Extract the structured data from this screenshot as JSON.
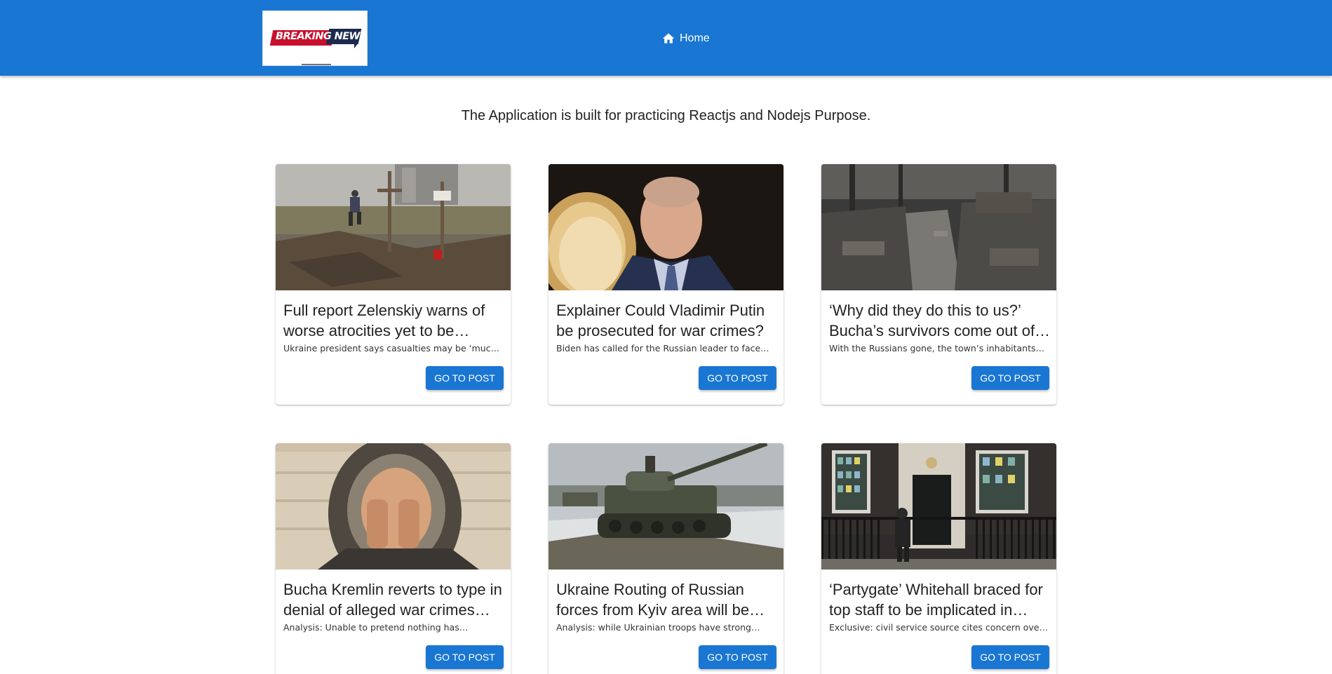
{
  "header": {
    "logo_text": "BREAKING NEWS",
    "nav_home_label": "Home",
    "home_icon": "home-icon"
  },
  "main": {
    "tagline": "The Application is built for practicing Reactjs and Nodejs Purpose."
  },
  "posts": [
    {
      "title": "Full report Zelenskiy warns of worse atrocities yet to be…",
      "description": "Ukraine president says casualties may be ‘much…",
      "button_label": "GO TO POST"
    },
    {
      "title": "Explainer Could Vladimir Putin be prosecuted for war crimes?",
      "description": "Biden has called for the Russian leader to face…",
      "button_label": "GO TO POST"
    },
    {
      "title": "‘Why did they do this to us?’ Bucha’s survivors come out of…",
      "description": "With the Russians gone, the town’s inhabitants…",
      "button_label": "GO TO POST"
    },
    {
      "title": "Bucha Kremlin reverts to type in denial of alleged war crimes in…",
      "description": "Analysis: Unable to pretend nothing has…",
      "button_label": "GO TO POST"
    },
    {
      "title": "Ukraine Routing of Russian forces from Kyiv area will be…",
      "description": "Analysis: while Ukrainian troops have strong…",
      "button_label": "GO TO POST"
    },
    {
      "title": "‘Partygate’ Whitehall braced for top staff to be implicated in Su…",
      "description": "Exclusive: civil service source cites concern over…",
      "button_label": "GO TO POST"
    }
  ],
  "colors": {
    "appbar": "#1976d2",
    "button": "#1976d2",
    "logo_red": "#c8102e",
    "logo_navy": "#1b2a4e"
  }
}
